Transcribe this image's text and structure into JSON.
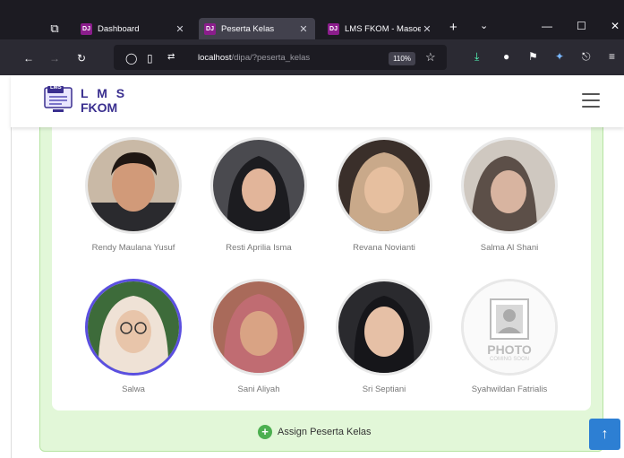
{
  "browser": {
    "tabs": [
      {
        "label": "Dashboard",
        "favicon": "DJ",
        "active": false
      },
      {
        "label": "Peserta Kelas",
        "favicon": "DJ",
        "active": true
      },
      {
        "label": "LMS FKOM - Masoe",
        "favicon": "DJ",
        "active": false
      }
    ],
    "url_host": "localhost",
    "url_path": "/dipa/?peserta_kelas",
    "zoom": "110%"
  },
  "site": {
    "logo_badge": "LMS",
    "logo_line1": "L M S",
    "logo_line2": "FKOM"
  },
  "members": [
    {
      "name": "Rendy Maulana Yusuf",
      "photo": "photo"
    },
    {
      "name": "Resti Aprilia Isma",
      "photo": "photo"
    },
    {
      "name": "Revana Novianti",
      "photo": "photo"
    },
    {
      "name": "Salma Al Shani",
      "photo": "photo"
    },
    {
      "name": "Salwa",
      "photo": "photo",
      "selected": true
    },
    {
      "name": "Sani Aliyah",
      "photo": "photo"
    },
    {
      "name": "Sri Septiani",
      "photo": "photo"
    },
    {
      "name": "Syahwildan Fatrialis",
      "photo": "placeholder",
      "placeholder_text": "PHOTO",
      "placeholder_sub": "COMING SOON"
    }
  ],
  "actions": {
    "assign_label": "Assign Peserta Kelas",
    "scroll_top": "↑"
  },
  "colors": {
    "accent": "#3a2f8f",
    "panel": "#e2f7d8",
    "add": "#4caf50",
    "scroll_btn": "#2d7fd3",
    "selected_ring": "#5b4fe0"
  }
}
